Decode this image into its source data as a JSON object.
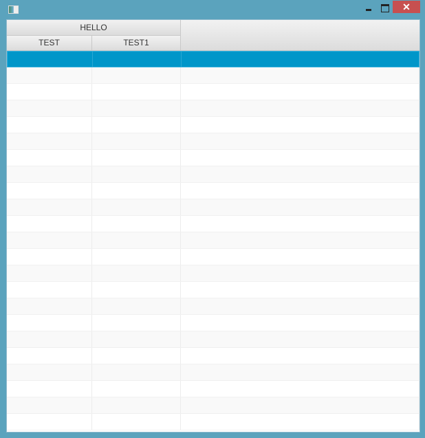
{
  "window": {
    "close_glyph": "✕"
  },
  "table": {
    "group_header": "HELLO",
    "columns": [
      "TEST",
      "TEST1"
    ],
    "selected_row": 0
  }
}
